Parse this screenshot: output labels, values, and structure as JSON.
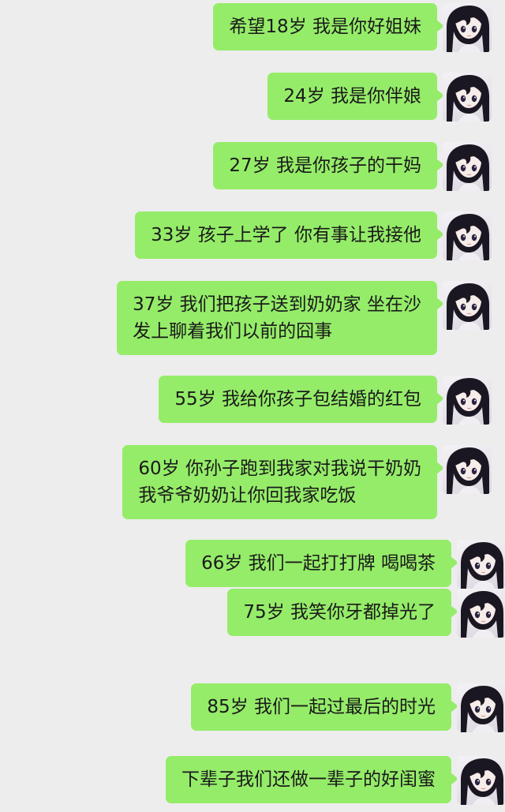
{
  "chat": {
    "messages": [
      {
        "text": "希望18岁 我是你好姐妹"
      },
      {
        "text": "24岁 我是你伴娘"
      },
      {
        "text": "27岁 我是你孩子的干妈"
      },
      {
        "text": "33岁 孩子上学了 你有事让我接他"
      },
      {
        "text": "37岁 我们把孩子送到奶奶家 坐在沙\n发上聊着我们以前的囧事"
      },
      {
        "text": "55岁 我给你孩子包结婚的红包"
      },
      {
        "text": "60岁 你孙子跑到我家对我说干奶奶\n我爷爷奶奶让你回我家吃饭"
      },
      {
        "text": "66岁 我们一起打打牌 喝喝茶"
      },
      {
        "text": "75岁 我笑你牙都掉光了"
      },
      {
        "text": "85岁 我们一起过最后的时光"
      },
      {
        "text": "下辈子我们还做一辈子的好闺蜜"
      }
    ],
    "avatar_icon": "anime-girl-avatar-icon",
    "colors": {
      "background": "#ededed",
      "bubble": "#95ec69"
    }
  }
}
